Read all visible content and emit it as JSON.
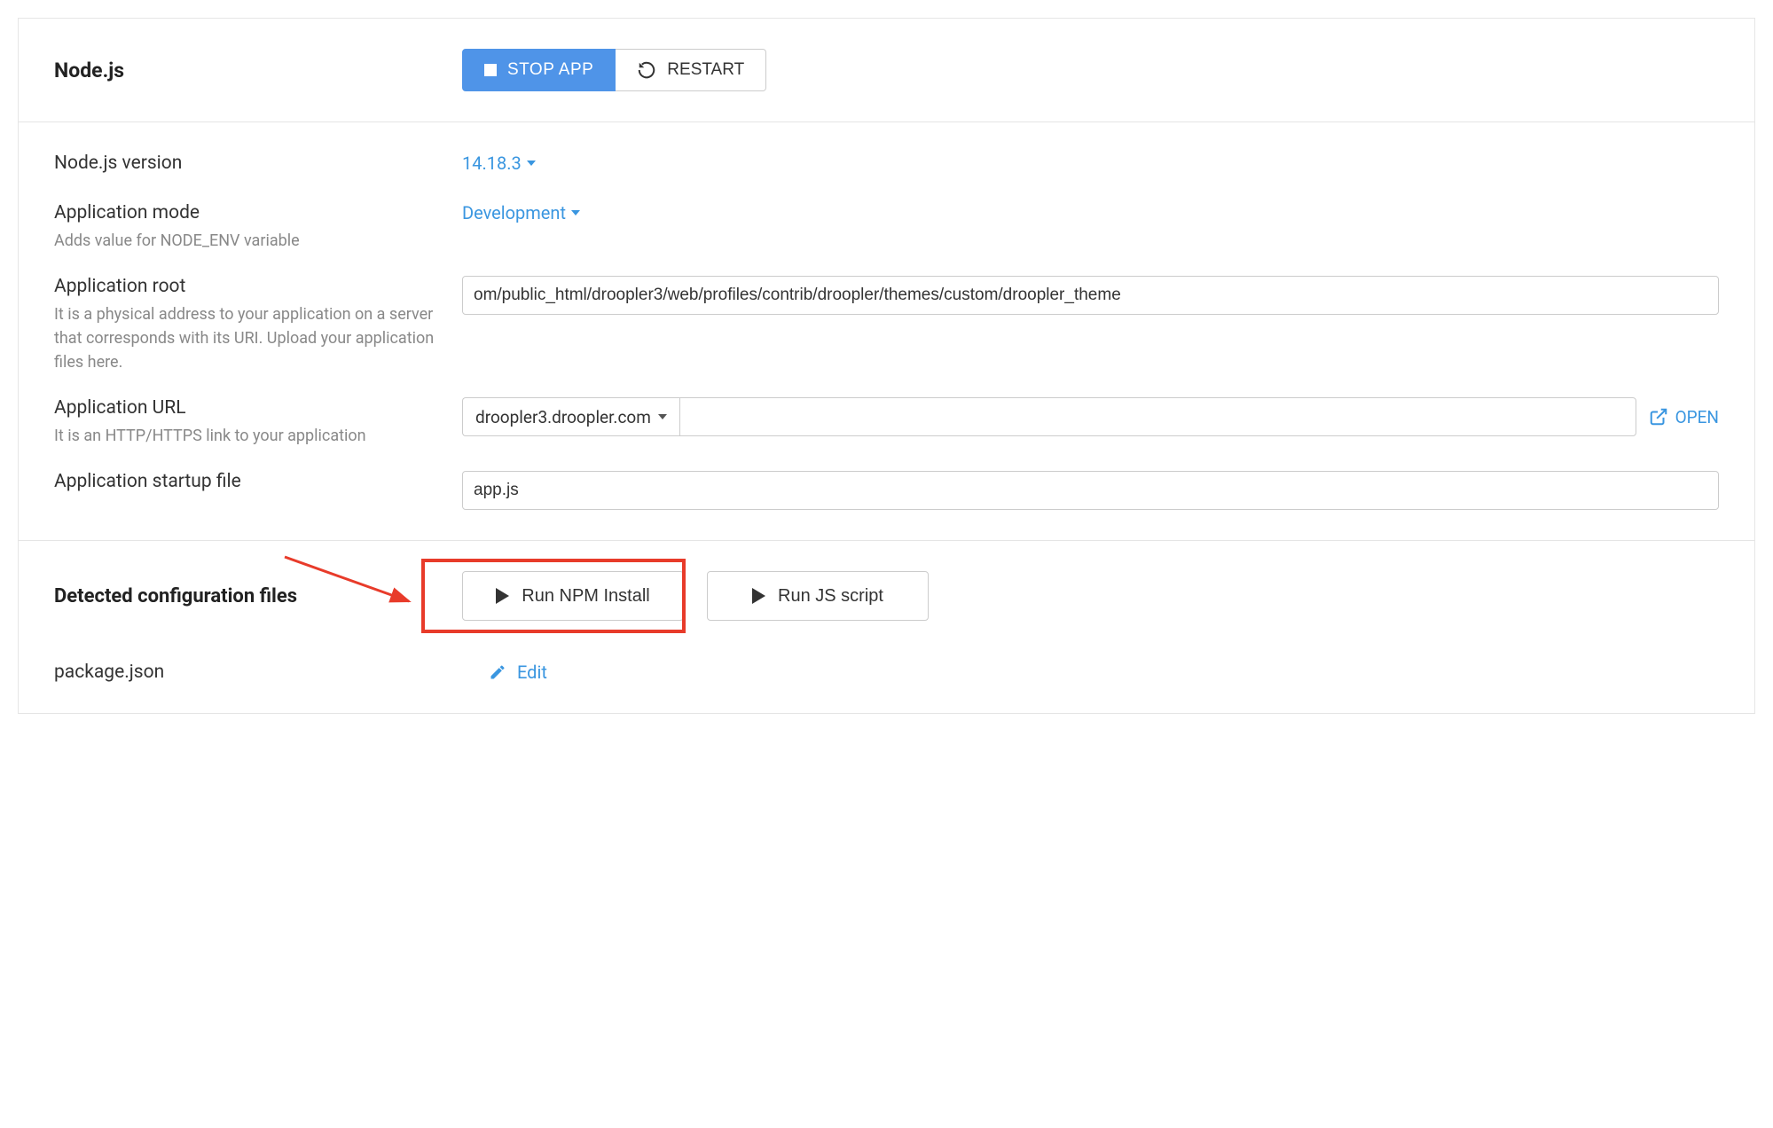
{
  "header": {
    "title": "Node.js",
    "stop_label": "STOP APP",
    "restart_label": "RESTART"
  },
  "form": {
    "version": {
      "label": "Node.js version",
      "value": "14.18.3"
    },
    "mode": {
      "label": "Application mode",
      "help": "Adds value for NODE_ENV variable",
      "value": "Development"
    },
    "root": {
      "label": "Application root",
      "help": "It is a physical address to your application on a server that corresponds with its URI. Upload your application files here.",
      "value": "om/public_html/droopler3/web/profiles/contrib/droopler/themes/custom/droopler_theme"
    },
    "url": {
      "label": "Application URL",
      "help": "It is an HTTP/HTTPS link to your application",
      "domain": "droopler3.droopler.com",
      "path": "",
      "open_label": "OPEN"
    },
    "startup": {
      "label": "Application startup file",
      "value": "app.js"
    }
  },
  "config": {
    "heading": "Detected configuration files",
    "npm_install_label": "Run NPM Install",
    "run_js_label": "Run JS script",
    "file": "package.json",
    "edit_label": "Edit"
  }
}
